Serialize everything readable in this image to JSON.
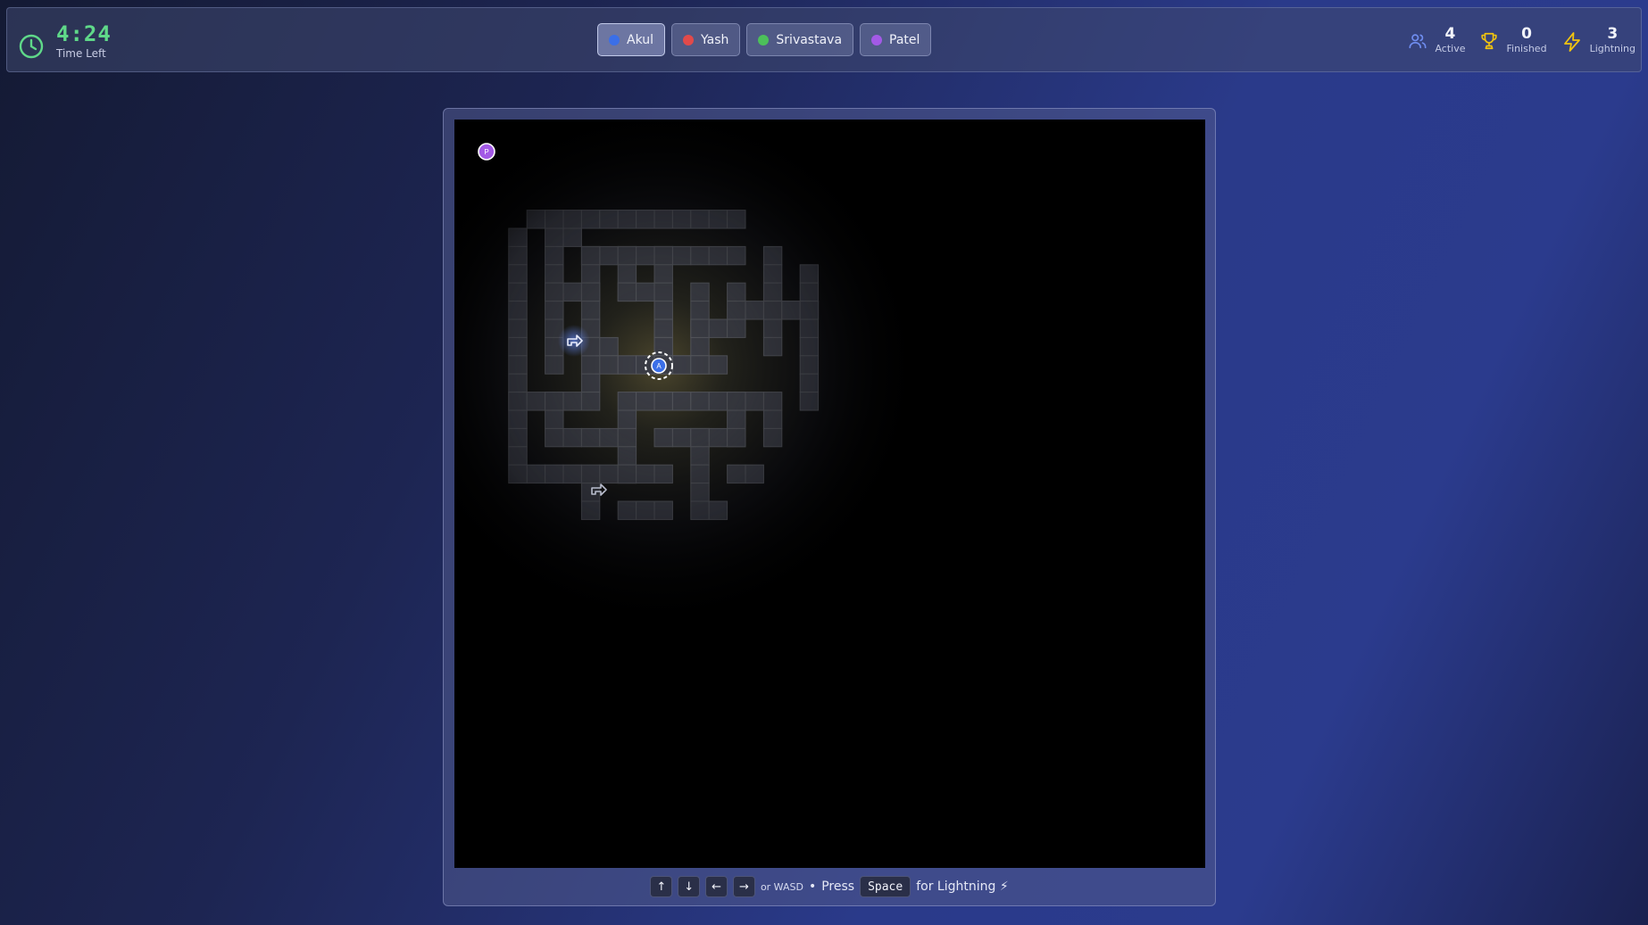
{
  "header": {
    "timer": {
      "value": "4:24",
      "label": "Time Left",
      "icon": "clock-icon"
    },
    "players": [
      {
        "name": "Akul",
        "color": "#3b6fe8",
        "selected": true
      },
      {
        "name": "Yash",
        "color": "#e14a4a",
        "selected": false
      },
      {
        "name": "Srivastava",
        "color": "#4cc05a",
        "selected": false
      },
      {
        "name": "Patel",
        "color": "#a35ae6",
        "selected": false
      }
    ],
    "stats": [
      {
        "icon": "users-icon",
        "value": "4",
        "label": "Active",
        "color": "#6f8df0"
      },
      {
        "icon": "trophy-icon",
        "value": "0",
        "label": "Finished",
        "color": "#f1c40f"
      },
      {
        "icon": "lightning-icon",
        "value": "3",
        "label": "Lightning",
        "color": "#f1c40f"
      }
    ]
  },
  "maze": {
    "player_markers": [
      {
        "letter": "A",
        "player": "Akul",
        "color": "#3b6fe8"
      },
      {
        "letter": "P",
        "player": "Patel",
        "color": "#a35ae6"
      }
    ],
    "powerups": [
      "powerup-icon",
      "powerup-icon"
    ]
  },
  "controls": {
    "keys": [
      "↑",
      "↓",
      "←",
      "→"
    ],
    "alt": "or WASD",
    "separator": "•",
    "press": "Press",
    "space_key": "Space",
    "action": "for Lightning ⚡"
  }
}
